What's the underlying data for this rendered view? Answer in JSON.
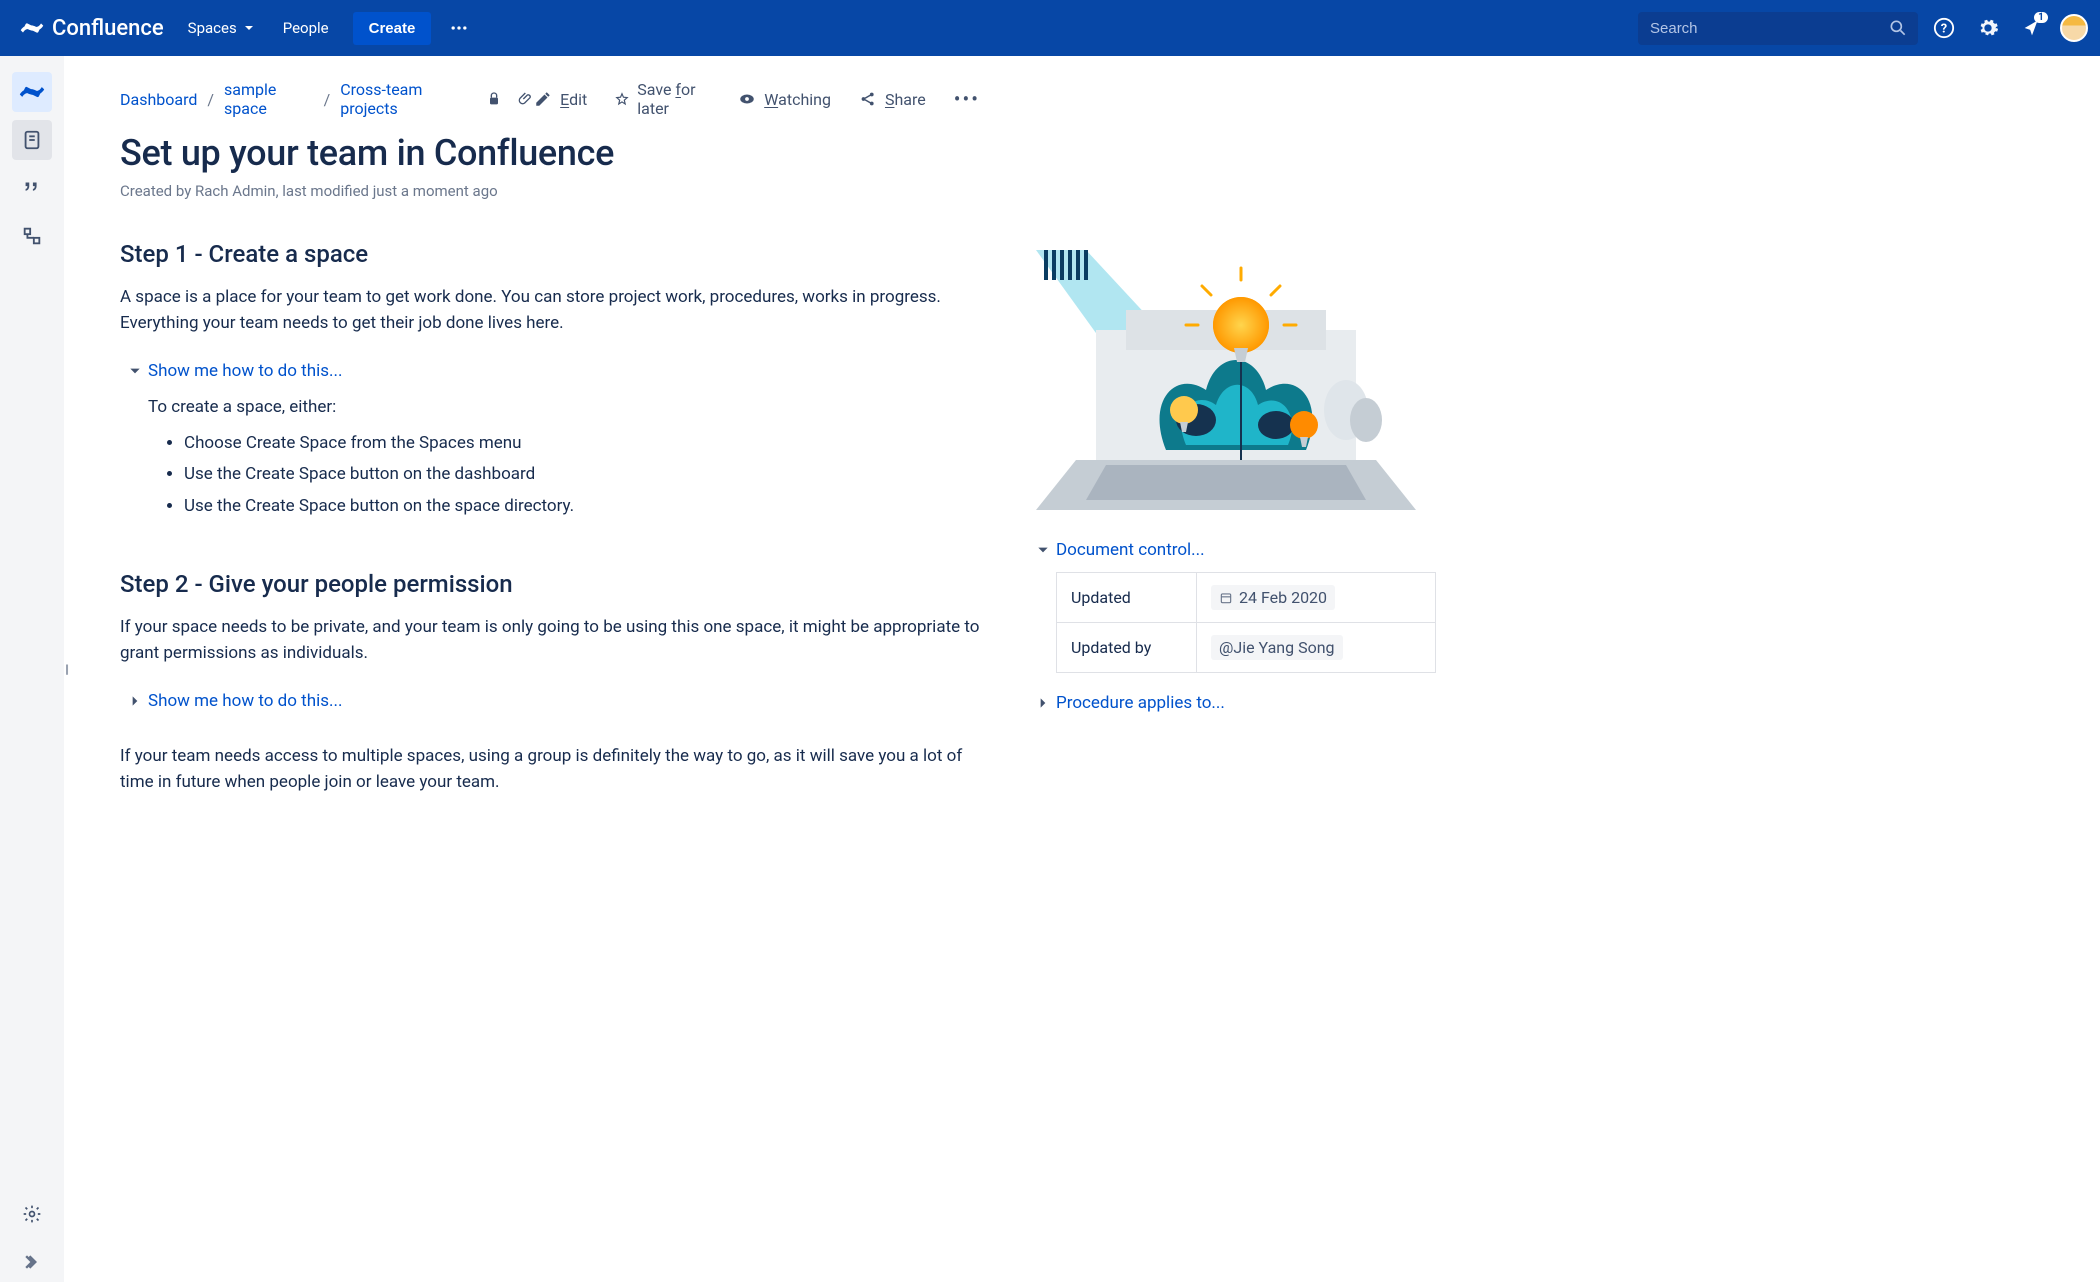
{
  "header": {
    "product": "Confluence",
    "nav": {
      "spaces": "Spaces",
      "people": "People"
    },
    "create": "Create",
    "search_placeholder": "Search",
    "notification_count": "1"
  },
  "breadcrumbs": [
    "Dashboard",
    "sample space",
    "Cross-team projects"
  ],
  "page_actions": {
    "edit": "Edit",
    "save": "Save for later",
    "watching": "Watching",
    "share": "Share"
  },
  "page": {
    "title": "Set up your team in Confluence",
    "byline": "Created by Rach Admin, last modified just a moment ago"
  },
  "step1": {
    "heading": "Step 1 - Create a space",
    "body": "A space is a place for your team to get work done.  You can store project work, procedures, works in progress. Everything your team needs to get their job done lives here.",
    "expander": "Show me how to do this...",
    "intro": "To create a space, either:",
    "bullets": [
      "Choose Create Space from the Spaces menu",
      "Use the Create Space button on the dashboard",
      "Use the Create Space button on the space directory."
    ]
  },
  "step2": {
    "heading": "Step 2 - Give your people permission",
    "body1": "If your space needs to be private, and your team is only going to be using this one space, it might be appropriate to grant permissions as individuals.",
    "expander": "Show me how to do this...",
    "body2": "If your team needs access to multiple spaces, using a group is definitely the way to go, as it will save you a lot of time in future when people join or leave your team."
  },
  "side": {
    "doc_control": "Document control...",
    "updated_label": "Updated",
    "updated_value": "24 Feb 2020",
    "updated_by_label": "Updated by",
    "updated_by_value": "@Jie Yang Song",
    "procedure": "Procedure applies to..."
  }
}
